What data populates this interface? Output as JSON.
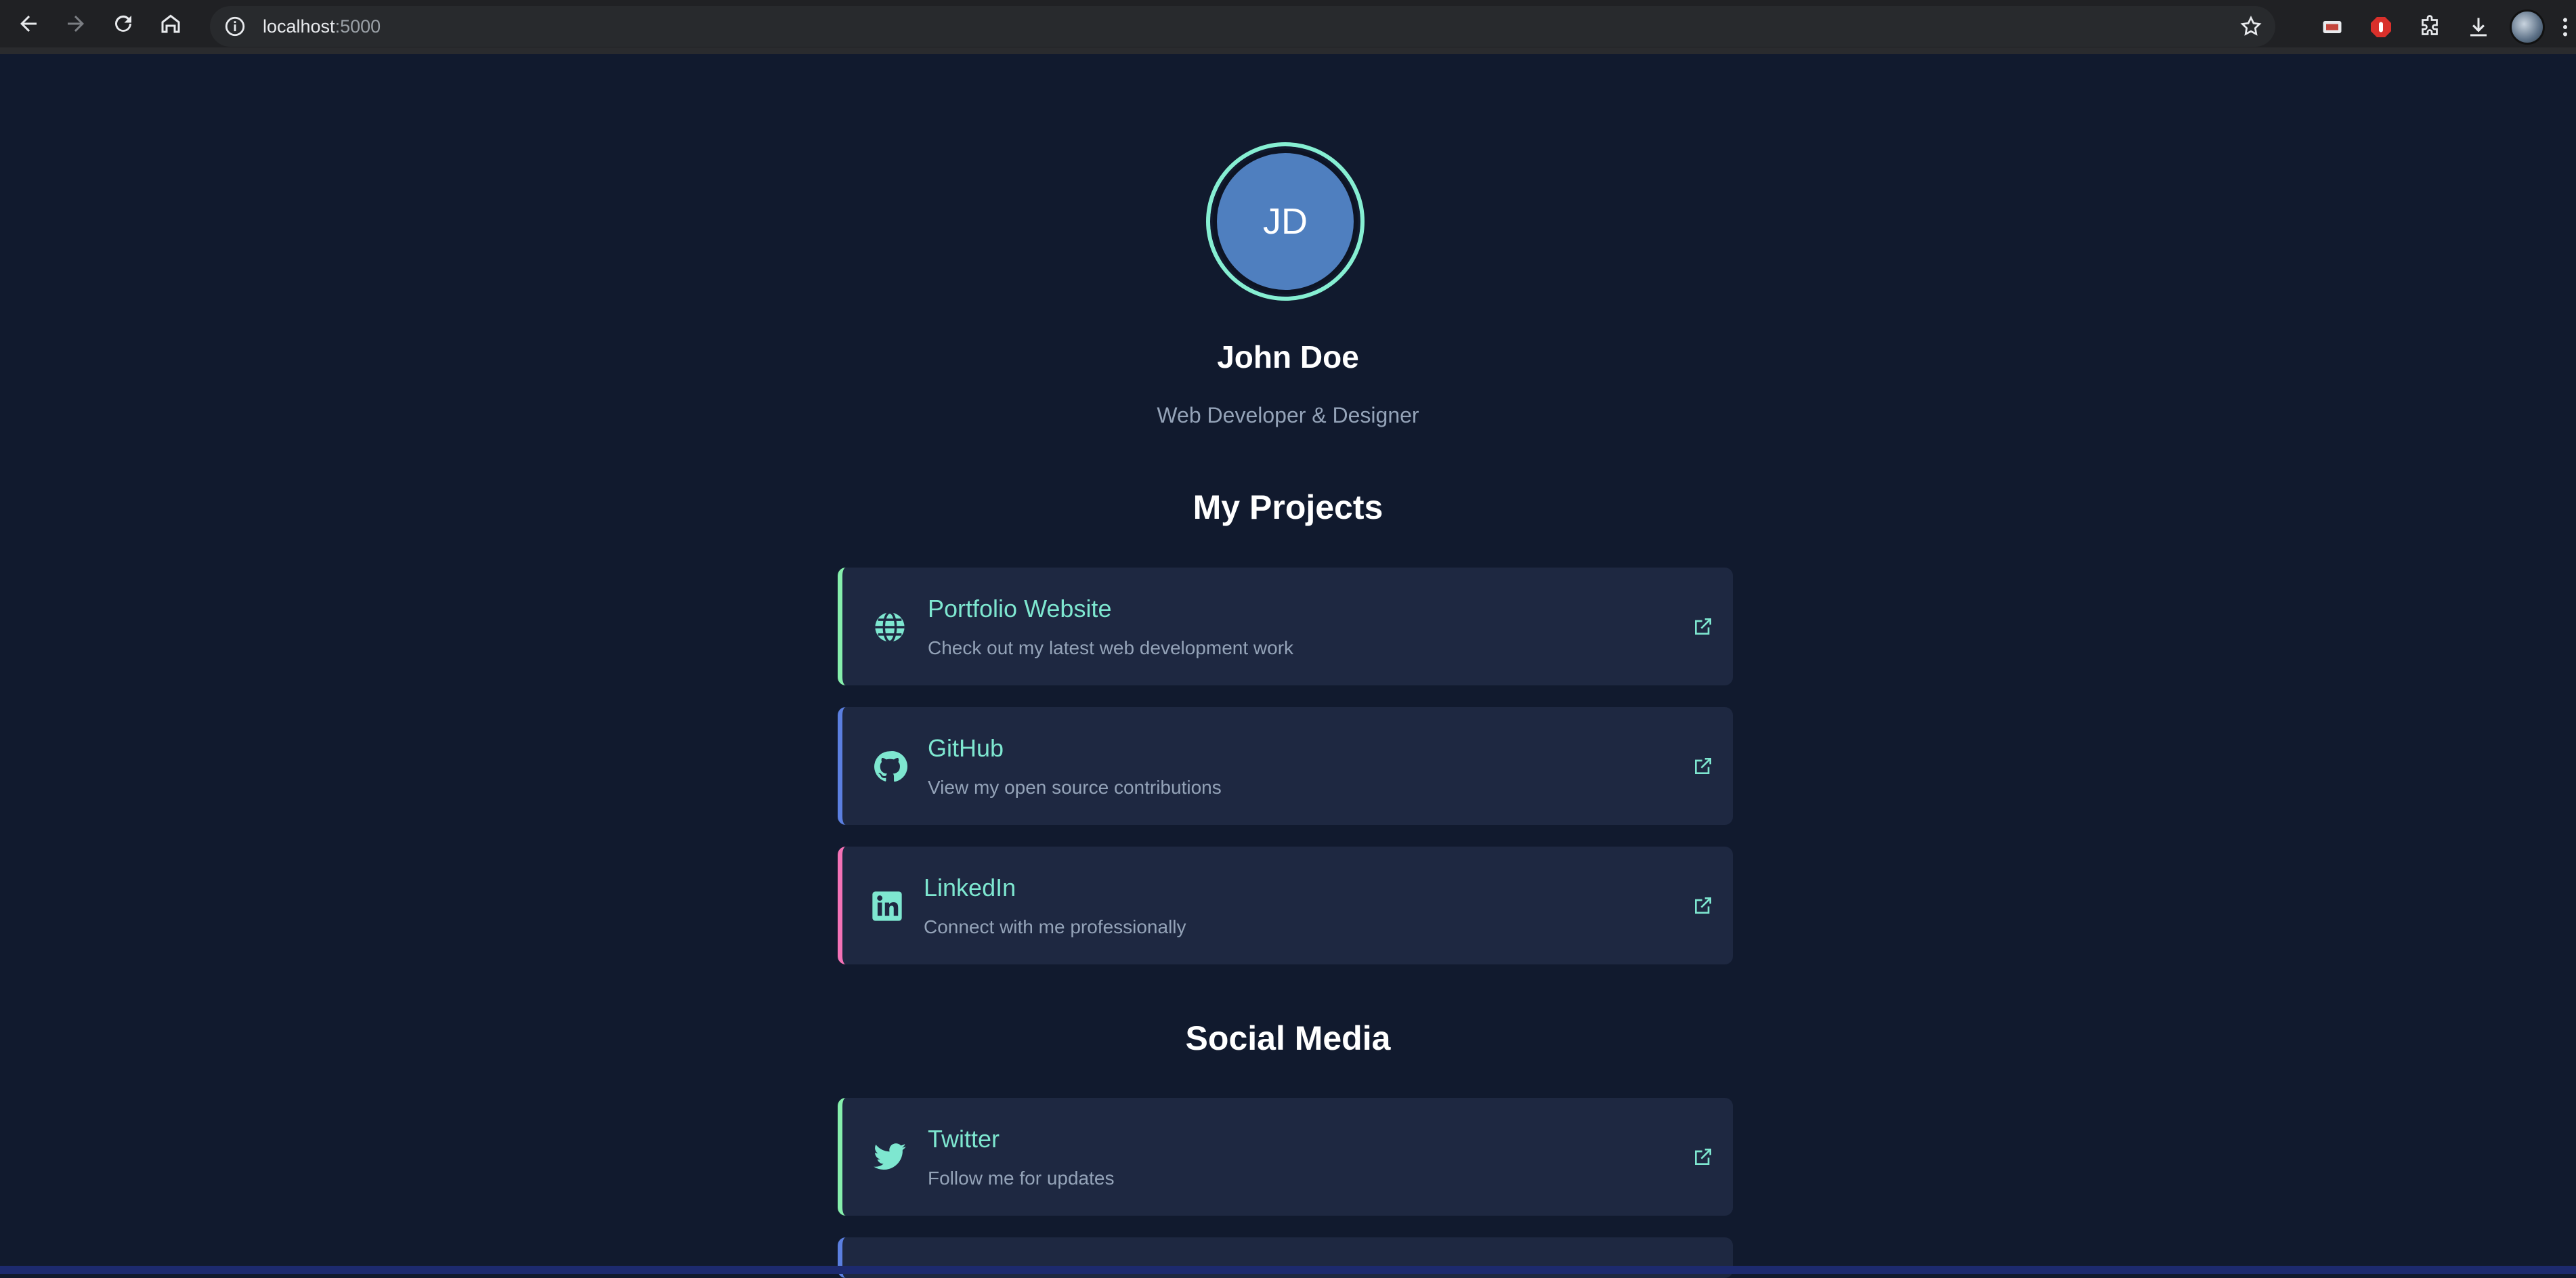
{
  "browser": {
    "url_host": "localhost",
    "url_port": ":5000"
  },
  "profile": {
    "initials": "JD",
    "name": "John Doe",
    "tagline": "Web Developer & Designer"
  },
  "projects": {
    "heading": "My Projects",
    "items": [
      {
        "title": "Portfolio Website",
        "description": "Check out my latest web development work",
        "icon": "globe-icon",
        "accent": "#86efac"
      },
      {
        "title": "GitHub",
        "description": "View my open source contributions",
        "icon": "github-icon",
        "accent": "#5b7fe0"
      },
      {
        "title": "LinkedIn",
        "description": "Connect with me professionally",
        "icon": "linkedin-icon",
        "accent": "#f472b6"
      }
    ]
  },
  "social": {
    "heading": "Social Media",
    "items": [
      {
        "title": "Twitter",
        "description": "Follow me for updates",
        "icon": "twitter-icon",
        "accent": "#86efac"
      },
      {
        "title": "",
        "description": "",
        "icon": "",
        "accent": "#5b7fe0"
      }
    ]
  },
  "colors": {
    "background": "#111a2e",
    "card": "#1e2841",
    "accent_text": "#7ee7d0",
    "avatar": "#4f7fbf"
  }
}
